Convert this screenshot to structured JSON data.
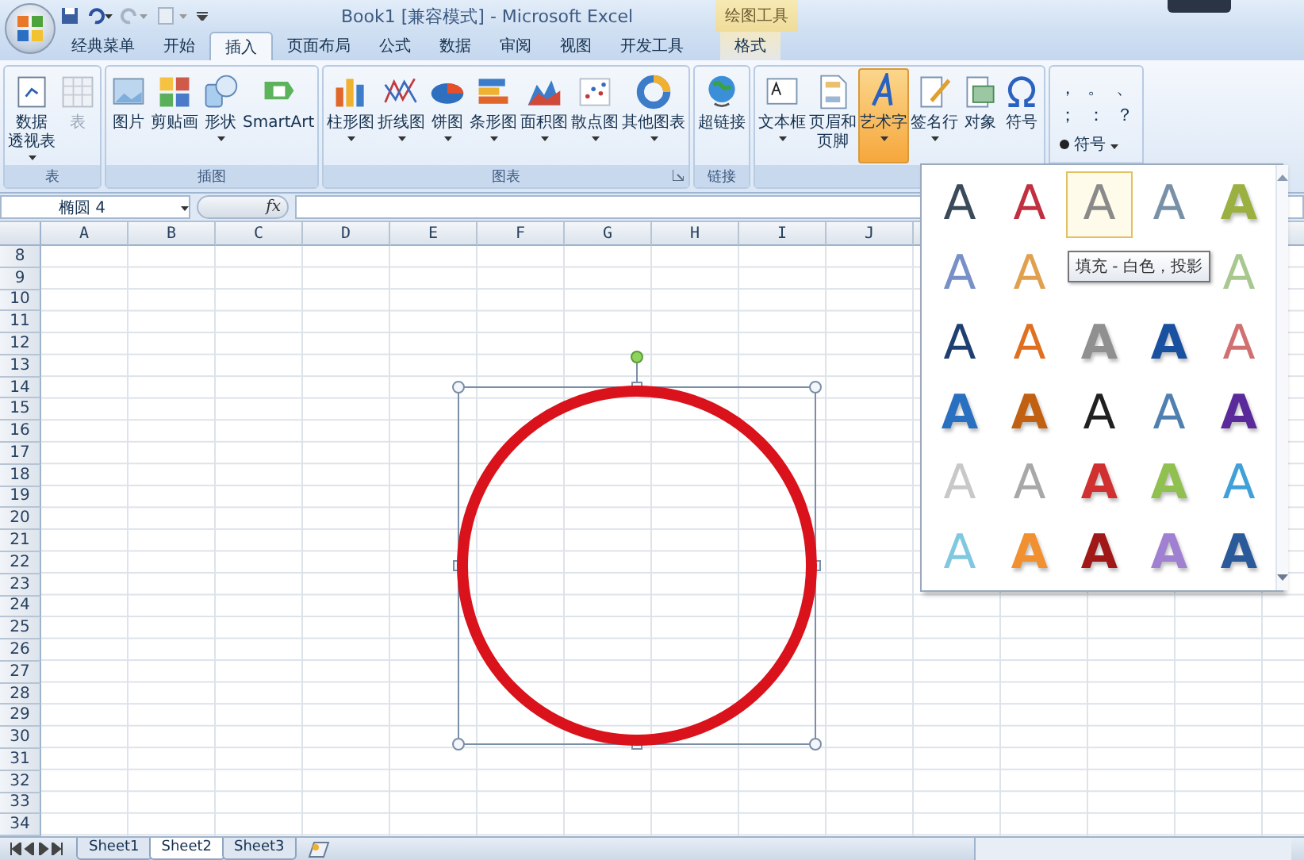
{
  "title_bar": {
    "document": "Book1  [兼容模式] - Microsoft Excel",
    "context_label": "绘图工具"
  },
  "tabs": [
    {
      "label": "经典菜单",
      "selected": false,
      "kind": "normal"
    },
    {
      "label": "开始",
      "selected": false,
      "kind": "normal"
    },
    {
      "label": "插入",
      "selected": true,
      "kind": "normal"
    },
    {
      "label": "页面布局",
      "selected": false,
      "kind": "normal"
    },
    {
      "label": "公式",
      "selected": false,
      "kind": "normal"
    },
    {
      "label": "数据",
      "selected": false,
      "kind": "normal"
    },
    {
      "label": "审阅",
      "selected": false,
      "kind": "normal"
    },
    {
      "label": "视图",
      "selected": false,
      "kind": "normal"
    },
    {
      "label": "开发工具",
      "selected": false,
      "kind": "normal"
    },
    {
      "label": "格式",
      "selected": false,
      "kind": "context"
    }
  ],
  "ribbon": {
    "groups": [
      {
        "label": "表",
        "launcher": false,
        "buttons": [
          {
            "lines": [
              "数据",
              "透视表"
            ],
            "dropdown": true,
            "disabled": false,
            "selected": false
          },
          {
            "lines": [
              "表"
            ],
            "dropdown": false,
            "disabled": true,
            "selected": false
          }
        ]
      },
      {
        "label": "插图",
        "launcher": false,
        "buttons": [
          {
            "lines": [
              "图片"
            ],
            "dropdown": false,
            "disabled": false,
            "selected": false
          },
          {
            "lines": [
              "剪贴画"
            ],
            "dropdown": false,
            "disabled": false,
            "selected": false
          },
          {
            "lines": [
              "形状"
            ],
            "dropdown": true,
            "disabled": false,
            "selected": false
          },
          {
            "lines": [
              "SmartArt"
            ],
            "dropdown": false,
            "disabled": false,
            "selected": false
          }
        ]
      },
      {
        "label": "图表",
        "launcher": true,
        "buttons": [
          {
            "lines": [
              "柱形图"
            ],
            "dropdown": true,
            "disabled": false,
            "selected": false
          },
          {
            "lines": [
              "折线图"
            ],
            "dropdown": true,
            "disabled": false,
            "selected": false
          },
          {
            "lines": [
              "饼图"
            ],
            "dropdown": true,
            "disabled": false,
            "selected": false
          },
          {
            "lines": [
              "条形图"
            ],
            "dropdown": true,
            "disabled": false,
            "selected": false
          },
          {
            "lines": [
              "面积图"
            ],
            "dropdown": true,
            "disabled": false,
            "selected": false
          },
          {
            "lines": [
              "散点图"
            ],
            "dropdown": true,
            "disabled": false,
            "selected": false
          },
          {
            "lines": [
              "其他图表"
            ],
            "dropdown": true,
            "disabled": false,
            "selected": false
          }
        ]
      },
      {
        "label": "链接",
        "launcher": false,
        "buttons": [
          {
            "lines": [
              "超链接"
            ],
            "dropdown": false,
            "disabled": false,
            "selected": false
          }
        ]
      },
      {
        "launcher": false,
        "buttons": [
          {
            "lines": [
              "文本框"
            ],
            "dropdown": true,
            "disabled": false,
            "selected": false
          },
          {
            "lines": [
              "页眉和",
              "页脚"
            ],
            "dropdown": false,
            "disabled": false,
            "selected": false
          },
          {
            "lines": [
              "艺术字"
            ],
            "dropdown": true,
            "disabled": false,
            "selected": true
          },
          {
            "lines": [
              "签名行"
            ],
            "dropdown": true,
            "disabled": false,
            "selected": false
          },
          {
            "lines": [
              "对象"
            ],
            "dropdown": false,
            "disabled": false,
            "selected": false
          },
          {
            "lines": [
              "符号"
            ],
            "dropdown": false,
            "disabled": false,
            "selected": false
          }
        ]
      }
    ],
    "symbols": {
      "marks": [
        "，",
        "。",
        "、",
        "；",
        "：",
        "？"
      ],
      "button": "符号"
    }
  },
  "formula_bar": {
    "name_box": "椭圆 4",
    "function_label": "fx"
  },
  "columns": [
    "A",
    "B",
    "C",
    "D",
    "E",
    "F",
    "G",
    "H",
    "I",
    "J"
  ],
  "rows": [
    "8",
    "9",
    "10",
    "11",
    "12",
    "13",
    "14",
    "15",
    "16",
    "17",
    "18",
    "19",
    "20",
    "21",
    "22",
    "23",
    "24",
    "25",
    "26",
    "27",
    "28",
    "29",
    "30",
    "31",
    "32",
    "33",
    "34"
  ],
  "gallery": {
    "tooltip": "填充 - 白色，投影",
    "items": [
      {
        "label": "A",
        "kind": "outline",
        "color": "#3a4a5a",
        "selected": false
      },
      {
        "label": "A",
        "kind": "outline",
        "color": "#c03040",
        "selected": false
      },
      {
        "label": "A",
        "kind": "outline",
        "color": "#8a8a8a",
        "selected": true
      },
      {
        "label": "A",
        "kind": "outline",
        "color": "#7890a8",
        "selected": false
      },
      {
        "label": "A",
        "kind": "fill",
        "color": "#9ab040",
        "selected": false
      },
      {
        "label": "A",
        "kind": "outline",
        "color": "#7890c8",
        "selected": false
      },
      {
        "label": "A",
        "kind": "outline",
        "color": "#e0a050",
        "selected": false
      },
      {
        "selected": false
      },
      {
        "selected": false
      },
      {
        "label": "A",
        "kind": "outline",
        "color": "#a8c890",
        "selected": false
      },
      {
        "label": "A",
        "kind": "outline",
        "color": "#1f3f70",
        "selected": false
      },
      {
        "label": "A",
        "kind": "outline",
        "color": "#e07020",
        "selected": false
      },
      {
        "label": "A",
        "kind": "fill",
        "color": "#909090",
        "selected": false
      },
      {
        "label": "A",
        "kind": "fill",
        "color": "#1a50a0",
        "selected": false
      },
      {
        "label": "A",
        "kind": "outline",
        "color": "#d07070",
        "selected": false
      },
      {
        "label": "A",
        "kind": "fill",
        "color": "#2a70c0",
        "selected": false
      },
      {
        "label": "A",
        "kind": "fill",
        "color": "#c06010",
        "selected": false
      },
      {
        "label": "A",
        "kind": "outline",
        "color": "#202020",
        "selected": false
      },
      {
        "label": "A",
        "kind": "outline",
        "color": "#5080b0",
        "selected": false
      },
      {
        "label": "A",
        "kind": "fill",
        "color": "#5a2a9a",
        "selected": false
      },
      {
        "label": "A",
        "kind": "outline",
        "color": "#c8c8c8",
        "selected": false
      },
      {
        "label": "A",
        "kind": "outline",
        "color": "#a8a8a8",
        "selected": false
      },
      {
        "label": "A",
        "kind": "fill",
        "color": "#d03030",
        "selected": false
      },
      {
        "label": "A",
        "kind": "fill",
        "color": "#90c050",
        "selected": false
      },
      {
        "label": "A",
        "kind": "outline",
        "color": "#40a0d8",
        "selected": false
      },
      {
        "label": "A",
        "kind": "outline",
        "color": "#80c8e0",
        "selected": false
      },
      {
        "label": "A",
        "kind": "fill",
        "color": "#f09030",
        "selected": false
      },
      {
        "label": "A",
        "kind": "fill",
        "color": "#a01818",
        "selected": false
      },
      {
        "label": "A",
        "kind": "fill",
        "color": "#a080d0",
        "selected": false
      },
      {
        "label": "A",
        "kind": "fill",
        "color": "#2a5a9a",
        "selected": false
      }
    ]
  },
  "sheets": [
    {
      "label": "Sheet1",
      "selected": false
    },
    {
      "label": "Sheet2",
      "selected": true
    },
    {
      "label": "Sheet3",
      "selected": false
    }
  ]
}
